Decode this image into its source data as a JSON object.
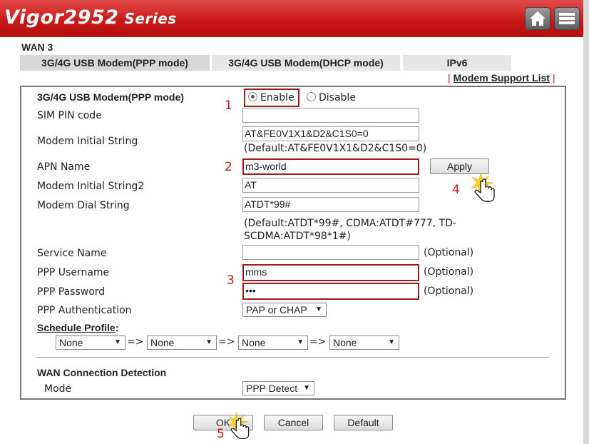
{
  "header": {
    "brand": "Vigor2952",
    "series": "Series"
  },
  "wan_title": "WAN 3",
  "tabs": [
    {
      "label": "3G/4G USB Modem(PPP mode)"
    },
    {
      "label": "3G/4G USB Modem(DHCP mode)"
    },
    {
      "label": "IPv6"
    }
  ],
  "support_link": "Modem Support List",
  "form": {
    "mode_label": "3G/4G USB Modem(PPP mode)",
    "enable_label": "Enable",
    "disable_label": "Disable",
    "sim_pin_label": "SIM PIN code",
    "sim_pin_value": "",
    "init_string_label": "Modem Initial String",
    "init_string_value": "AT&FE0V1X1&D2&C1S0=0",
    "init_string_default": "(Default:AT&FE0V1X1&D2&C1S0=0)",
    "apn_label": "APN Name",
    "apn_value": "m3-world",
    "apply_label": "Apply",
    "init_string2_label": "Modem Initial String2",
    "init_string2_value": "AT",
    "dial_string_label": "Modem Dial String",
    "dial_string_value": "ATDT*99#",
    "dial_default_line1": "(Default:ATDT*99#, CDMA:ATDT#777, TD-",
    "dial_default_line2": "SCDMA:ATDT*98*1#)",
    "service_name_label": "Service Name",
    "service_name_value": "",
    "optional": "(Optional)",
    "username_label": "PPP Username",
    "username_value": "mms",
    "password_label": "PPP Password",
    "password_value": "•••",
    "auth_label": "PPP Authentication",
    "auth_value": "PAP or CHAP",
    "schedule_label": "Schedule Profile",
    "schedule_colon": ":",
    "schedule_values": [
      "None",
      "None",
      "None",
      "None"
    ],
    "schedule_arrow": "=>",
    "detection_label": "WAN Connection Detection",
    "detect_mode_label": "Mode",
    "detect_mode_value": "PPP Detect"
  },
  "annotations": [
    "1",
    "2",
    "3",
    "4",
    "5"
  ],
  "buttons": {
    "ok": "OK",
    "cancel": "Cancel",
    "default": "Default"
  },
  "colors": {
    "header_red": "#c81515",
    "annotation_red": "#cc1111"
  }
}
